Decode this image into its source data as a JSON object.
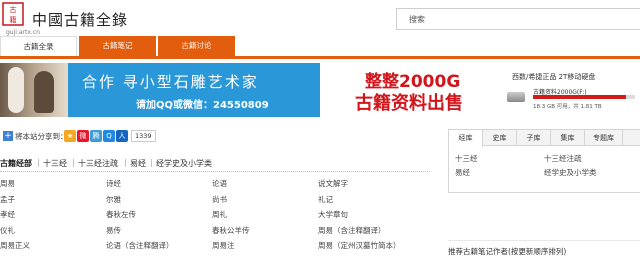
{
  "header": {
    "site_title": "中國古籍全錄",
    "site_url": "guji.artx.cn",
    "search_placeholder": "搜索"
  },
  "nav": {
    "tabs": [
      {
        "label": "古籍全录",
        "active": true
      },
      {
        "label": "古籍笔记",
        "active": false
      },
      {
        "label": "古籍讨论",
        "active": false
      }
    ]
  },
  "banners": {
    "left": {
      "line1": "合作  寻小型石雕艺术家",
      "line2": "请加QQ或微信：24550809"
    },
    "right": {
      "line1": "整整2000G",
      "line2": "古籍资料出售",
      "hd_title": "西数/希捷正品 2T移动硬盘",
      "hd_name": "古籍资料2000G(F:)",
      "hd_usage_fraction": 0.91,
      "hd_stats": "18.3 GB 可用，共 1.81 TB"
    }
  },
  "share": {
    "label": "将本站分享到：",
    "icons": [
      {
        "name": "qzone-icon",
        "glyph": "★",
        "color": "#f5a623"
      },
      {
        "name": "weibo-icon",
        "glyph": "微",
        "color": "#e6162d"
      },
      {
        "name": "tencent-weibo-icon",
        "glyph": "腾",
        "color": "#3b9cd9"
      },
      {
        "name": "qq-icon",
        "glyph": "Q",
        "color": "#1e88e5"
      },
      {
        "name": "renren-icon",
        "glyph": "人",
        "color": "#1565c0"
      }
    ],
    "count": "1339"
  },
  "categories": {
    "main": "古籍经部",
    "items": [
      "十三经",
      "十三经注疏",
      "易经",
      "经学史及小学类"
    ]
  },
  "books": {
    "rows": [
      [
        "周易",
        "诗经",
        "论语",
        "说文解字"
      ],
      [
        "孟子",
        "尔雅",
        "尚书",
        "礼记"
      ],
      [
        "孝经",
        "春秋左传",
        "周礼",
        "大学章句"
      ],
      [
        "仪礼",
        "易传",
        "春秋公羊传",
        "周易（含注释翻译）"
      ],
      [
        "周易正义",
        "论语（含注释翻译）",
        "周易注",
        "周易（定州汉墓竹简本）"
      ]
    ]
  },
  "right_panel": {
    "tabs": [
      {
        "label": "经库",
        "active": true
      },
      {
        "label": "史库",
        "active": false
      },
      {
        "label": "子库",
        "active": false
      },
      {
        "label": "集库",
        "active": false
      },
      {
        "label": "专题库",
        "active": false
      }
    ],
    "items": [
      "十三经",
      "十三经注疏",
      "易经",
      "经学史及小学类"
    ]
  },
  "notes": {
    "title": "推荐古籍笔记作者(按更新顺序排列)"
  }
}
